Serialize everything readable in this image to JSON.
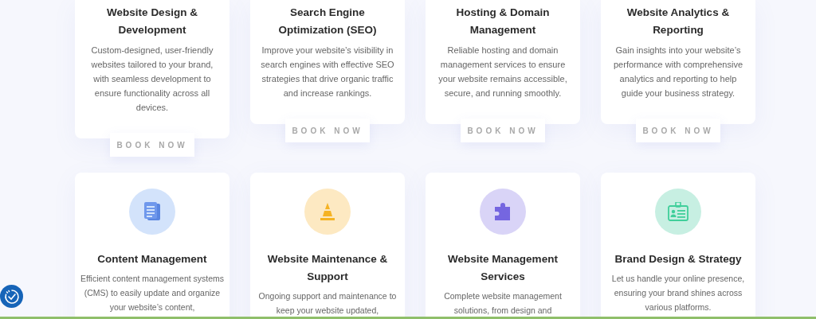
{
  "top_services": [
    {
      "title": "Website Design & Development",
      "description": "Custom-designed, user-friendly websites tailored to your brand, with seamless development to ensure functionality across all devices.",
      "button": "BOOK NOW"
    },
    {
      "title": "Search Engine Optimization (SEO)",
      "description": "Improve your website’s visibility in search engines with effective SEO strategies that drive organic traffic and increase rankings.",
      "button": "BOOK NOW"
    },
    {
      "title": "Hosting & Domain Management",
      "description": "Reliable hosting and domain management services to ensure your website remains accessible, secure, and running smoothly.",
      "button": "BOOK NOW"
    },
    {
      "title": "Website Analytics & Reporting",
      "description": "Gain insights into your website’s performance with comprehensive analytics and reporting to help guide your business strategy.",
      "button": "BOOK NOW"
    }
  ],
  "services": [
    {
      "title": "Content Management",
      "description": "Efficient content management systems (CMS) to easily update and organize your website’s content,"
    },
    {
      "title": "Website Maintenance & Support",
      "description": "Ongoing support and maintenance to keep your website updated,"
    },
    {
      "title": "Website Management Services",
      "description": "Complete website management solutions, from design and"
    },
    {
      "title": "Brand Design & Strategy",
      "description": "Let us handle your online presence, ensuring your brand shines across various platforms."
    }
  ]
}
